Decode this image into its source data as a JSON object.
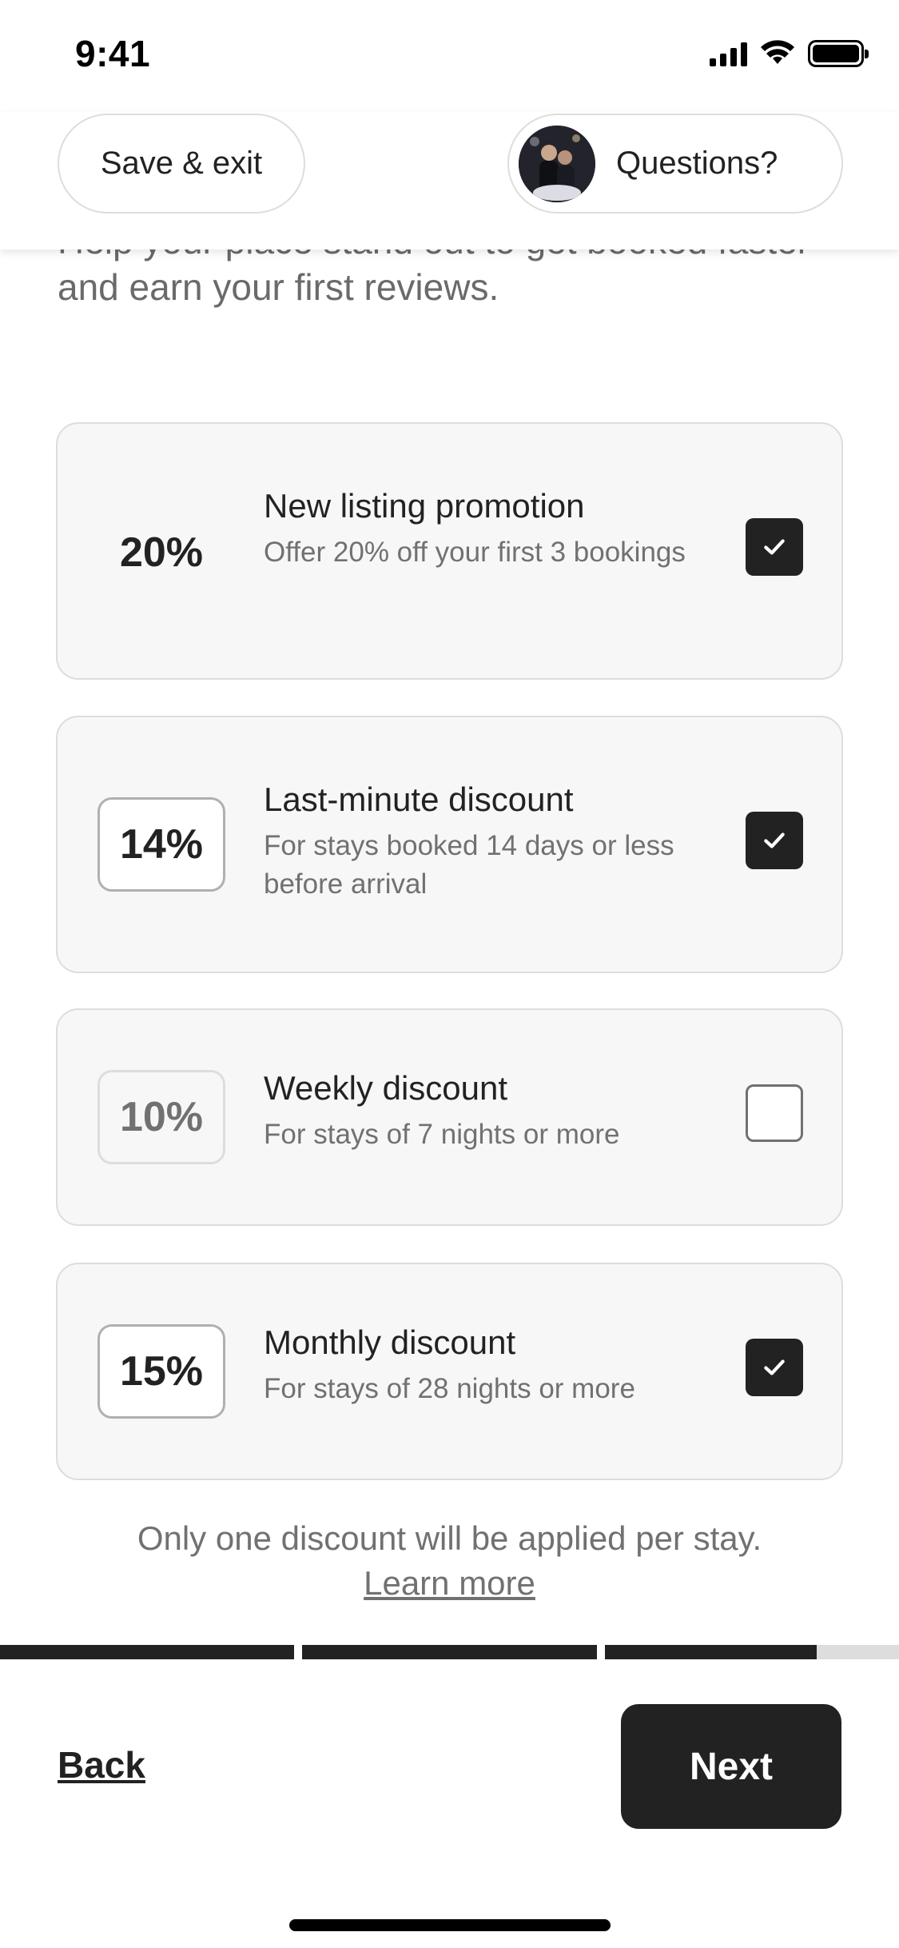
{
  "status_bar": {
    "time": "9:41"
  },
  "header": {
    "save_exit_label": "Save & exit",
    "questions_label": "Questions?"
  },
  "intro": {
    "subtitle": "Help your place stand out to get booked faster and earn your first reviews."
  },
  "discounts": [
    {
      "percent": "20%",
      "title": "New listing promotion",
      "description": "Offer 20% off your first 3 bookings",
      "checked": true
    },
    {
      "percent": "14%",
      "title": "Last-minute discount",
      "description": "For stays booked 14 days or less before arrival",
      "checked": true
    },
    {
      "percent": "10%",
      "title": "Weekly discount",
      "description": "For stays of 7 nights or more",
      "checked": false
    },
    {
      "percent": "15%",
      "title": "Monthly discount",
      "description": "For stays of 28 nights or more",
      "checked": true
    }
  ],
  "note": {
    "text": "Only one discount will be applied per stay.",
    "link": "Learn more"
  },
  "progress": {
    "step_fills": [
      1.0,
      1.0,
      0.72
    ]
  },
  "footer": {
    "back_label": "Back",
    "next_label": "Next"
  },
  "icons": {
    "check": "checkmark-icon",
    "avatar": "host-avatar"
  },
  "colors": {
    "accent": "#222222",
    "muted_text": "#717171",
    "card_bg": "#f7f7f7",
    "border": "#dddddd"
  }
}
